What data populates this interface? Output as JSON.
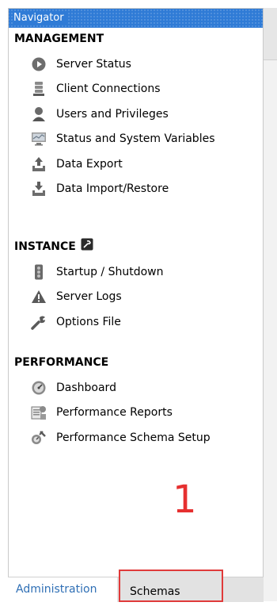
{
  "navigator": {
    "title": "Navigator",
    "sections": [
      {
        "title": "MANAGEMENT",
        "items": [
          {
            "label": "Server Status",
            "icon": "play-circle-icon"
          },
          {
            "label": "Client Connections",
            "icon": "server-stack-icon"
          },
          {
            "label": "Users and Privileges",
            "icon": "user-icon"
          },
          {
            "label": "Status and System Variables",
            "icon": "monitor-icon"
          },
          {
            "label": "Data Export",
            "icon": "upload-tray-icon"
          },
          {
            "label": "Data Import/Restore",
            "icon": "download-tray-icon"
          }
        ]
      },
      {
        "title": "INSTANCE",
        "title_icon": "instance-settings-icon",
        "items": [
          {
            "label": "Startup / Shutdown",
            "icon": "traffic-light-icon"
          },
          {
            "label": "Server Logs",
            "icon": "warning-icon"
          },
          {
            "label": "Options File",
            "icon": "wrench-icon"
          }
        ]
      },
      {
        "title": "PERFORMANCE",
        "items": [
          {
            "label": "Dashboard",
            "icon": "gauge-icon"
          },
          {
            "label": "Performance Reports",
            "icon": "reports-icon"
          },
          {
            "label": "Performance Schema Setup",
            "icon": "schema-setup-icon"
          }
        ]
      }
    ]
  },
  "tabs": {
    "administration": "Administration",
    "schemas": "Schemas"
  },
  "annotation": "1",
  "colors": {
    "titlebar": "#2f7bd6",
    "annotation": "#e63030",
    "active_tab_text": "#2f6fb5"
  }
}
